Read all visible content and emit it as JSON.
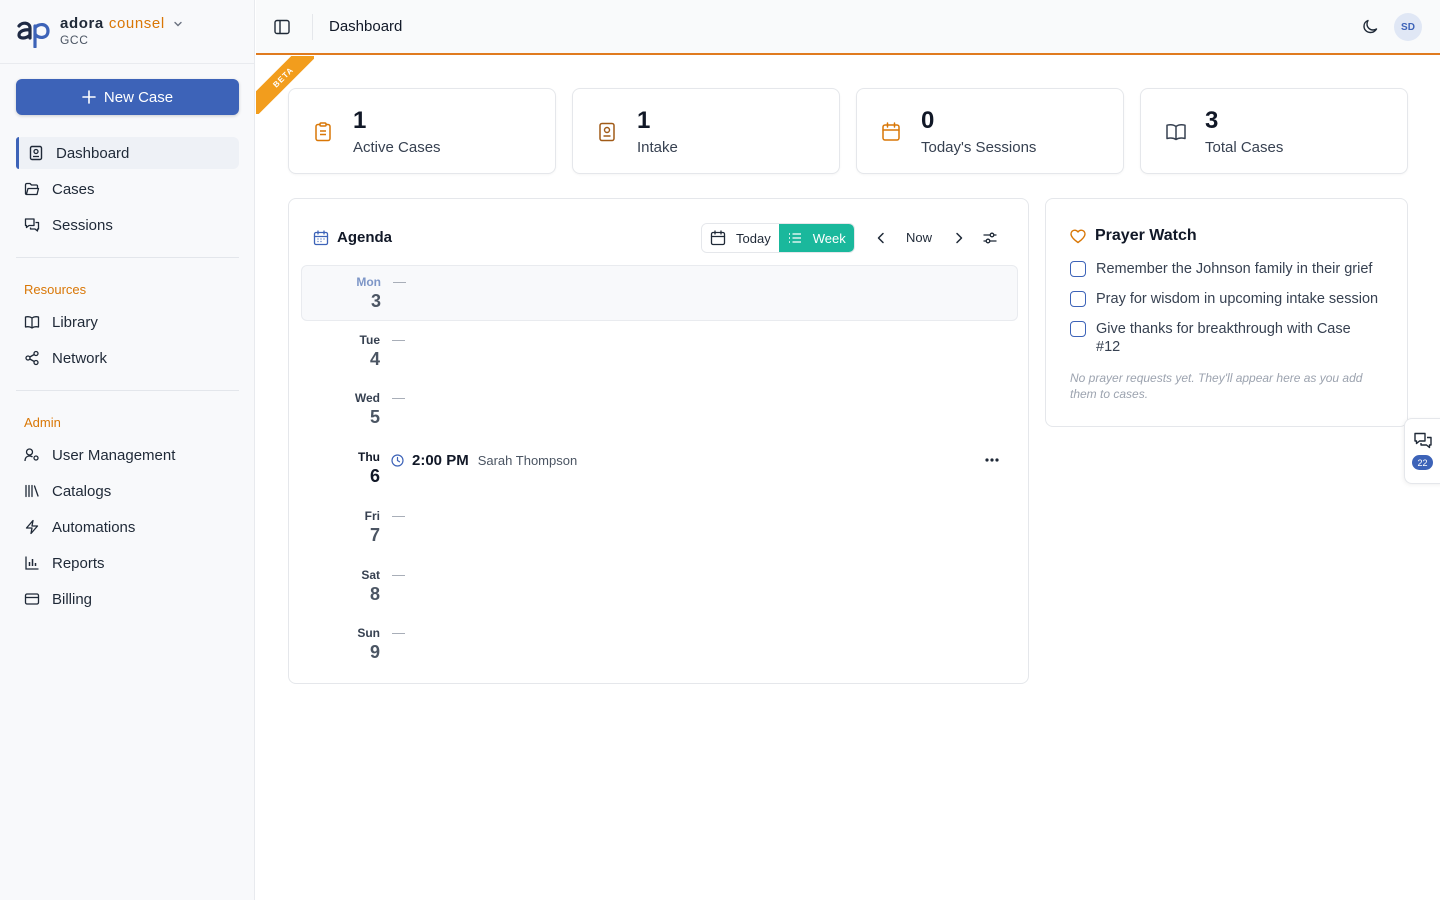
{
  "brand": {
    "name_a": "adora",
    "name_b": "counsel",
    "org": "GCC"
  },
  "actions": {
    "new_case": "New Case"
  },
  "nav": {
    "main": [
      {
        "label": "Dashboard",
        "icon": "case-file-icon"
      },
      {
        "label": "Cases",
        "icon": "folder-icon"
      },
      {
        "label": "Sessions",
        "icon": "chat-bubbles-icon"
      }
    ],
    "resources_title": "Resources",
    "resources": [
      {
        "label": "Library",
        "icon": "book-open-icon"
      },
      {
        "label": "Network",
        "icon": "share-nodes-icon"
      }
    ],
    "admin_title": "Admin",
    "admin": [
      {
        "label": "User Management",
        "icon": "user-key-icon"
      },
      {
        "label": "Catalogs",
        "icon": "library-icon"
      },
      {
        "label": "Automations",
        "icon": "lightning-icon"
      },
      {
        "label": "Reports",
        "icon": "bar-chart-icon"
      },
      {
        "label": "Billing",
        "icon": "credit-card-icon"
      }
    ]
  },
  "header": {
    "breadcrumb": "Dashboard",
    "avatar_initials": "SD",
    "beta": "BETA"
  },
  "stats": [
    {
      "value": "1",
      "label": "Active Cases",
      "icon": "clipboard-icon"
    },
    {
      "value": "1",
      "label": "Intake",
      "icon": "case-file-icon"
    },
    {
      "value": "0",
      "label": "Today's Sessions",
      "icon": "calendar-icon"
    },
    {
      "value": "3",
      "label": "Total Cases",
      "icon": "book-open-icon"
    }
  ],
  "agenda": {
    "title": "Agenda",
    "today_label": "Today",
    "week_label": "Week",
    "now_label": "Now",
    "empty_marker": "—",
    "days": [
      {
        "name": "Mon",
        "num": "3"
      },
      {
        "name": "Tue",
        "num": "4"
      },
      {
        "name": "Wed",
        "num": "5"
      },
      {
        "name": "Thu",
        "num": "6"
      },
      {
        "name": "Fri",
        "num": "7"
      },
      {
        "name": "Sat",
        "num": "8"
      },
      {
        "name": "Sun",
        "num": "9"
      }
    ],
    "event": {
      "time": "2:00 PM",
      "client": "Sarah Thompson"
    }
  },
  "prayer": {
    "title": "Prayer Watch",
    "items": [
      "Remember the Johnson family in their grief",
      "Pray for wisdom in upcoming intake session",
      "Give thanks for breakthrough with Case #12"
    ],
    "note": "No prayer requests yet. They'll appear here as you add them to cases."
  },
  "chat": {
    "badge": "22"
  },
  "colors": {
    "primary": "#3d63b8",
    "accent": "#d97706",
    "teal": "#1ab89c",
    "beta": "#f29d1d"
  }
}
